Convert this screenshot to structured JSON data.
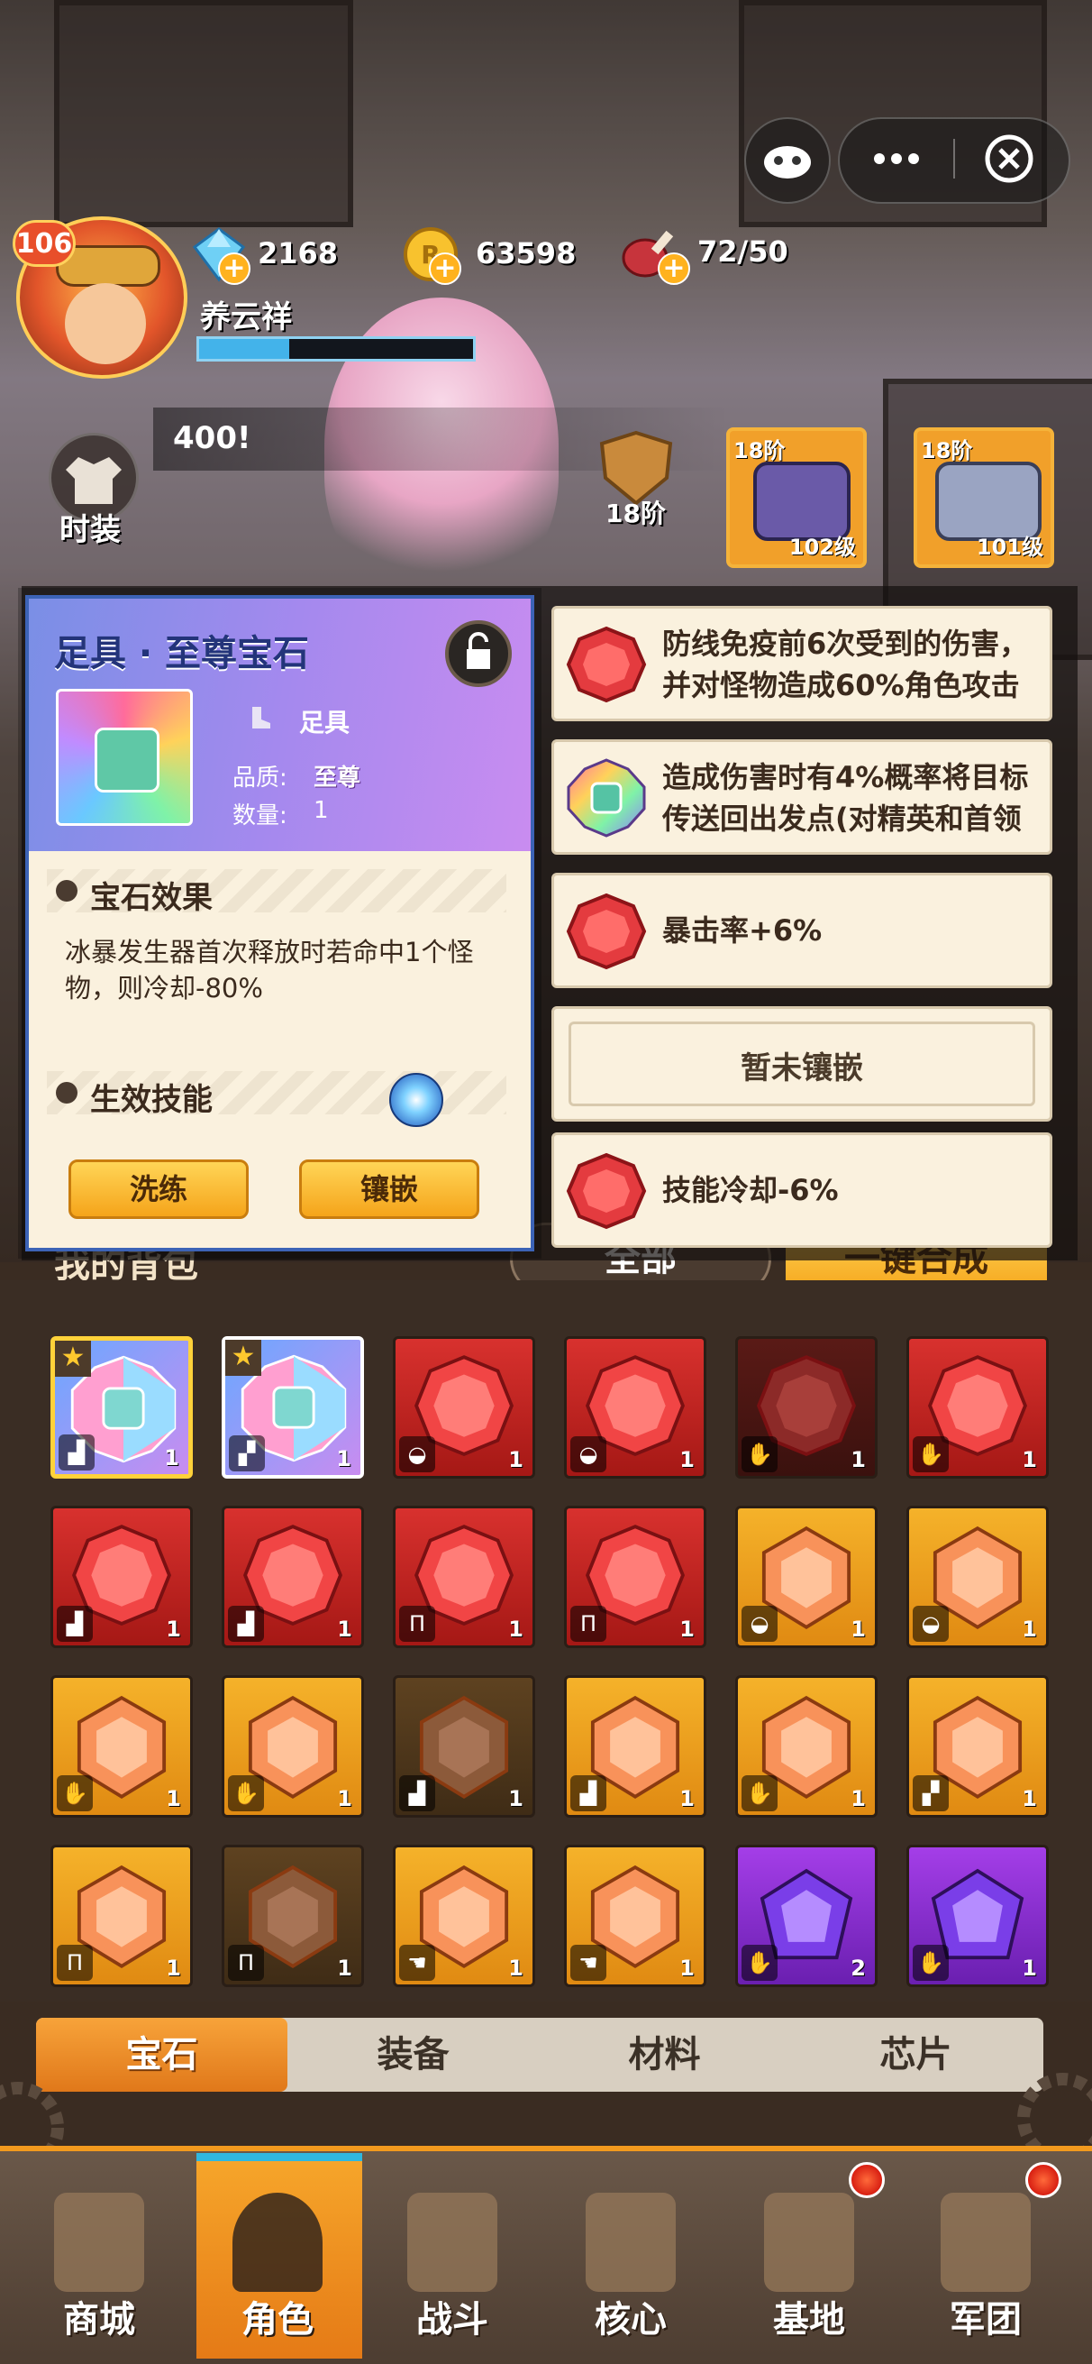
{
  "colors": {
    "accent": "#f29a1e",
    "red_gem": "#e2383c",
    "orange_gem": "#f2934a",
    "purple_gem": "#8b3fe0",
    "rainbow_gem": "#7fd7d0"
  },
  "header": {
    "level": "106",
    "player_name": "养云祥",
    "hp_fill": 0.33,
    "resources": [
      {
        "icon": "diamond-icon",
        "value": "2168"
      },
      {
        "icon": "coin-icon",
        "value": "63598"
      },
      {
        "icon": "meat-icon",
        "value": "72/50"
      }
    ]
  },
  "top_controls": {
    "more_icon": "more-dots-icon",
    "close_icon": "close-icon",
    "game_icon": "gamepad-icon"
  },
  "side": {
    "fashion_label": "时装"
  },
  "banner_text": "400!",
  "equip_cards": [
    {
      "rank": "18阶",
      "level": "102级"
    },
    {
      "rank": "18阶",
      "level": "101级"
    }
  ],
  "rank_badge": "18阶",
  "popup": {
    "title": "足具 · 至尊宝石",
    "slot_label": "足具",
    "quality_label": "品质:",
    "quality_value": "至尊",
    "count_label": "数量:",
    "count_value": "1",
    "effect_heading": "宝石效果",
    "effect_text": "冰暴发生器首次释放时若命中1个怪物，则冷却-80%",
    "skill_heading": "生效技能",
    "buttons": {
      "refine": "洗练",
      "inlay": "镶嵌"
    }
  },
  "gem_slots": [
    {
      "type": "red",
      "text": "防线免疫前6次受到的伤害，并对怪物造成60%角色攻击"
    },
    {
      "type": "rainbow",
      "text": "造成伤害时有4%概率将目标传送回出发点(对精英和首领"
    },
    {
      "type": "red",
      "text": "暴击率+6%"
    },
    {
      "type": "empty",
      "text": "暂未镶嵌"
    },
    {
      "type": "red",
      "text": "技能冷却-6%"
    }
  ],
  "bag_behind": {
    "title": "我的背包",
    "filter": "全部",
    "merge": "一键合成"
  },
  "bag": [
    [
      {
        "g": "rainbow",
        "s": "boot",
        "n": "1",
        "star": true,
        "sel": true
      },
      {
        "g": "rainbow",
        "s": "leg",
        "n": "1",
        "star": true
      },
      {
        "g": "red",
        "s": "helm",
        "n": "1"
      },
      {
        "g": "red",
        "s": "helm",
        "n": "1"
      },
      {
        "g": "red-dim",
        "s": "glove",
        "n": "1"
      },
      {
        "g": "red",
        "s": "glove",
        "n": "1"
      }
    ],
    [
      {
        "g": "red",
        "s": "boot",
        "n": "1"
      },
      {
        "g": "red",
        "s": "boot",
        "n": "1"
      },
      {
        "g": "red",
        "s": "pants",
        "n": "1"
      },
      {
        "g": "red",
        "s": "pants",
        "n": "1"
      },
      {
        "g": "orange",
        "s": "helm",
        "n": "1"
      },
      {
        "g": "orange",
        "s": "helm",
        "n": "1"
      }
    ],
    [
      {
        "g": "orange",
        "s": "glove",
        "n": "1"
      },
      {
        "g": "orange",
        "s": "glove",
        "n": "1"
      },
      {
        "g": "orange-dim",
        "s": "boot",
        "n": "1"
      },
      {
        "g": "orange",
        "s": "boot",
        "n": "1"
      },
      {
        "g": "orange",
        "s": "glove",
        "n": "1"
      },
      {
        "g": "orange",
        "s": "leg",
        "n": "1"
      }
    ],
    [
      {
        "g": "orange",
        "s": "pants",
        "n": "1"
      },
      {
        "g": "orange-dim",
        "s": "pants",
        "n": "1"
      },
      {
        "g": "orange",
        "s": "hand",
        "n": "1"
      },
      {
        "g": "orange",
        "s": "hand",
        "n": "1"
      },
      {
        "g": "purple",
        "s": "glove",
        "n": "2"
      },
      {
        "g": "purple",
        "s": "glove",
        "n": "1"
      }
    ]
  ],
  "tabs": [
    "宝石",
    "装备",
    "材料",
    "芯片"
  ],
  "active_tab": 0,
  "nav": [
    {
      "label": "商城",
      "icon": "shop-icon"
    },
    {
      "label": "角色",
      "icon": "character-icon",
      "active": true
    },
    {
      "label": "战斗",
      "icon": "battle-icon"
    },
    {
      "label": "核心",
      "icon": "core-icon"
    },
    {
      "label": "基地",
      "icon": "base-icon",
      "dot": true
    },
    {
      "label": "军团",
      "icon": "legion-icon",
      "dot": true
    }
  ]
}
